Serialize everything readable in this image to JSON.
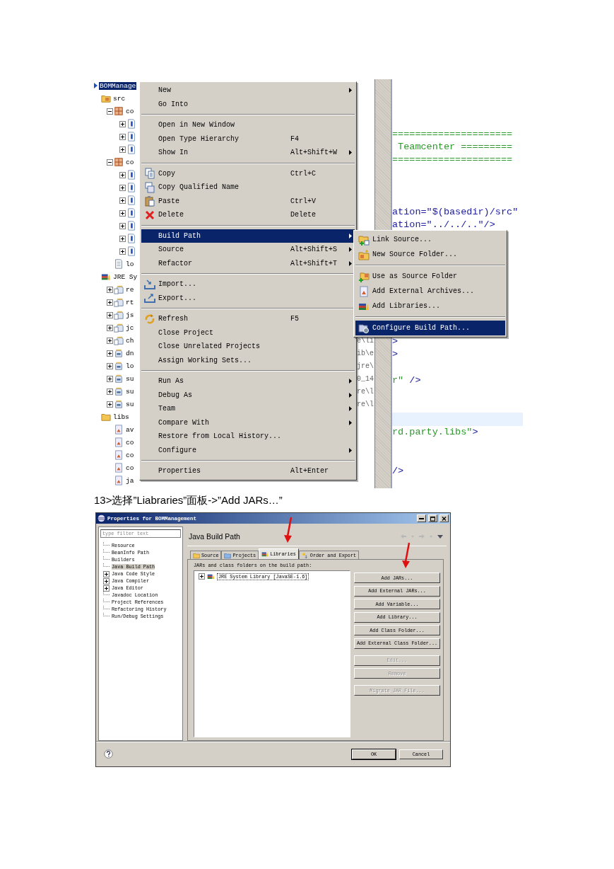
{
  "explorer": {
    "tree": [
      {
        "label": "BOMManage",
        "kind": "project",
        "selected": true,
        "children": [
          {
            "label": "src",
            "kind": "source-folder",
            "selected": false,
            "children": [
              {
                "label": "co",
                "kind": "package",
                "expanded": true,
                "selected": false,
                "children": [
                  {
                    "kind": "java",
                    "expanded": false,
                    "selected": false
                  },
                  {
                    "kind": "java",
                    "expanded": false,
                    "selected": false
                  },
                  {
                    "kind": "java",
                    "expanded": false,
                    "selected": false
                  }
                ]
              },
              {
                "label": "co",
                "kind": "package",
                "expanded": true,
                "selected": false,
                "children": [
                  {
                    "kind": "java",
                    "expanded": false,
                    "selected": false
                  },
                  {
                    "kind": "java",
                    "expanded": false,
                    "selected": false
                  },
                  {
                    "kind": "java",
                    "expanded": false,
                    "selected": false
                  },
                  {
                    "kind": "java",
                    "expanded": false,
                    "selected": false
                  },
                  {
                    "kind": "java",
                    "expanded": false,
                    "selected": false
                  },
                  {
                    "kind": "java",
                    "expanded": false,
                    "selected": false
                  },
                  {
                    "kind": "java",
                    "expanded": false,
                    "selected": false
                  }
                ]
              },
              {
                "label": "lo",
                "kind": "file",
                "selected": false
              }
            ]
          },
          {
            "label": "JRE Sy",
            "kind": "library",
            "selected": false,
            "children": [
              {
                "label": "re",
                "kind": "source-jar",
                "expanded": false,
                "selected": false
              },
              {
                "label": "rt",
                "kind": "source-jar",
                "expanded": false,
                "selected": false
              },
              {
                "label": "js",
                "kind": "source-jar",
                "expanded": false,
                "selected": false
              },
              {
                "label": "jc",
                "kind": "source-jar",
                "expanded": false,
                "selected": false
              },
              {
                "label": "ch",
                "kind": "source-jar",
                "expanded": false,
                "selected": false,
                "tail": "e\\li"
              },
              {
                "label": "dn",
                "kind": "jar",
                "expanded": false,
                "selected": false,
                "tail": "ib\\e"
              },
              {
                "label": "lo",
                "kind": "jar",
                "expanded": false,
                "selected": false,
                "tail": "jre\\"
              },
              {
                "label": "su",
                "kind": "jar",
                "expanded": false,
                "selected": false,
                "tail": "0_14"
              },
              {
                "label": "su",
                "kind": "jar",
                "expanded": false,
                "selected": false,
                "tail": "re\\l"
              },
              {
                "label": "su",
                "kind": "jar",
                "expanded": false,
                "selected": false,
                "tail": "re\\l"
              }
            ]
          },
          {
            "label": "libs",
            "kind": "folder",
            "selected": false,
            "children": [
              {
                "label": "av",
                "kind": "archive",
                "selected": false
              },
              {
                "label": "co",
                "kind": "archive",
                "selected": false
              },
              {
                "label": "co",
                "kind": "archive",
                "selected": false
              },
              {
                "label": "co",
                "kind": "archive",
                "selected": false
              },
              {
                "label": "ja",
                "kind": "archive",
                "selected": false
              }
            ]
          }
        ]
      }
    ]
  },
  "context_menu": {
    "items": [
      {
        "kind": "item",
        "label": "New",
        "has_submenu": true,
        "selected": false
      },
      {
        "kind": "item",
        "label": "Go Into",
        "has_submenu": false,
        "selected": false
      },
      {
        "kind": "separator"
      },
      {
        "kind": "item",
        "label": "Open in New Window",
        "has_submenu": false,
        "selected": false
      },
      {
        "kind": "item",
        "label": "Open Type Hierarchy",
        "shortcut": "F4",
        "has_submenu": false,
        "selected": false
      },
      {
        "kind": "item",
        "label": "Show In",
        "shortcut": "Alt+Shift+W",
        "has_submenu": true,
        "selected": false
      },
      {
        "kind": "separator"
      },
      {
        "kind": "copy",
        "label": "Copy",
        "shortcut": "Ctrl+C",
        "has_submenu": false,
        "selected": false
      },
      {
        "kind": "copyname",
        "label": "Copy Qualified Name",
        "has_submenu": false,
        "selected": false
      },
      {
        "kind": "paste",
        "label": "Paste",
        "shortcut": "Ctrl+V",
        "has_submenu": false,
        "selected": false
      },
      {
        "kind": "delete",
        "label": "Delete",
        "shortcut": "Delete",
        "has_submenu": false,
        "selected": false
      },
      {
        "kind": "separator"
      },
      {
        "kind": "item",
        "label": "Build Path",
        "has_submenu": true,
        "selected": true
      },
      {
        "kind": "item",
        "label": "Source",
        "shortcut": "Alt+Shift+S",
        "has_submenu": true,
        "selected": false
      },
      {
        "kind": "item",
        "label": "Refactor",
        "shortcut": "Alt+Shift+T",
        "has_submenu": true,
        "selected": false
      },
      {
        "kind": "separator"
      },
      {
        "kind": "import",
        "label": "Import...",
        "has_submenu": false,
        "selected": false
      },
      {
        "kind": "export",
        "label": "Export...",
        "has_submenu": false,
        "selected": false
      },
      {
        "kind": "separator"
      },
      {
        "kind": "refresh",
        "label": "Refresh",
        "shortcut": "F5",
        "has_submenu": false,
        "selected": false
      },
      {
        "kind": "item",
        "label": "Close Project",
        "has_submenu": false,
        "selected": false
      },
      {
        "kind": "item",
        "label": "Close Unrelated Projects",
        "has_submenu": false,
        "selected": false
      },
      {
        "kind": "item",
        "label": "Assign Working Sets...",
        "has_submenu": false,
        "selected": false
      },
      {
        "kind": "separator"
      },
      {
        "kind": "item",
        "label": "Run As",
        "has_submenu": true,
        "selected": false
      },
      {
        "kind": "item",
        "label": "Debug As",
        "has_submenu": true,
        "selected": false
      },
      {
        "kind": "item",
        "label": "Team",
        "has_submenu": true,
        "selected": false
      },
      {
        "kind": "item",
        "label": "Compare With",
        "has_submenu": true,
        "selected": false
      },
      {
        "kind": "item",
        "label": "Restore from Local History...",
        "has_submenu": false,
        "selected": false
      },
      {
        "kind": "item",
        "label": "Configure",
        "has_submenu": true,
        "selected": false
      },
      {
        "kind": "separator"
      },
      {
        "kind": "item",
        "label": "Properties",
        "shortcut": "Alt+Enter",
        "has_submenu": false,
        "selected": false
      }
    ]
  },
  "submenu": {
    "items": [
      {
        "kind": "link",
        "label": "Link Source...",
        "selected": false
      },
      {
        "kind": "newfolder",
        "label": "New Source Folder...",
        "selected": false
      },
      {
        "kind": "separator"
      },
      {
        "kind": "usesource",
        "label": "Use as Source Folder",
        "selected": false
      },
      {
        "kind": "archive",
        "label": "Add External Archives...",
        "selected": false
      },
      {
        "kind": "libraries",
        "label": "Add Libraries...",
        "selected": false
      },
      {
        "kind": "separator"
      },
      {
        "kind": "configure",
        "label": "Configure Build Path...",
        "selected": true
      }
    ]
  },
  "editor": {
    "lines": [
      {
        "kind": "blank"
      },
      {
        "kind": "blank"
      },
      {
        "kind": "blank"
      },
      {
        "kind": "code",
        "segments": [
          {
            "kind": "comment",
            "text": "====================="
          }
        ]
      },
      {
        "kind": "code",
        "segments": [
          {
            "kind": "comment",
            "text": " Teamcenter ========="
          }
        ]
      },
      {
        "kind": "code",
        "segments": [
          {
            "kind": "comment",
            "text": "====================="
          }
        ]
      },
      {
        "kind": "blank"
      },
      {
        "kind": "blank"
      },
      {
        "kind": "blank"
      },
      {
        "kind": "code",
        "segments": [
          {
            "kind": "markup",
            "text": "ation=\"$(basedir)/src\""
          }
        ]
      },
      {
        "kind": "code",
        "segments": [
          {
            "kind": "markup",
            "text": "ation=\"../../..\"/>"
          }
        ]
      },
      {
        "kind": "blank"
      },
      {
        "kind": "blank"
      },
      {
        "kind": "blank"
      },
      {
        "kind": "blank"
      },
      {
        "kind": "blank"
      },
      {
        "kind": "blank"
      },
      {
        "kind": "blank"
      },
      {
        "kind": "blank"
      },
      {
        "kind": "code",
        "segments": [
          {
            "kind": "markup",
            "text": ">"
          }
        ]
      },
      {
        "kind": "code",
        "segments": [
          {
            "kind": "markup",
            "text": ">"
          }
        ]
      },
      {
        "kind": "blank"
      },
      {
        "kind": "code",
        "segments": [
          {
            "kind": "comment",
            "text": "r\""
          },
          {
            "kind": "markup",
            "text": " />"
          }
        ]
      },
      {
        "kind": "blank"
      },
      {
        "kind": "blank"
      },
      {
        "kind": "current"
      },
      {
        "kind": "code",
        "segments": [
          {
            "kind": "comment",
            "text": "rd.party.libs\""
          },
          {
            "kind": "markup",
            "text": ">"
          }
        ]
      },
      {
        "kind": "blank"
      },
      {
        "kind": "blank"
      },
      {
        "kind": "code",
        "segments": [
          {
            "kind": "markup",
            "text": "/>"
          }
        ]
      }
    ]
  },
  "caption": "13>选择”Liabraries”面板->”Add JARs…”",
  "dialog": {
    "title": "Properties for BOMManagement",
    "filter": {
      "placeholder": "type filter text"
    },
    "nav": [
      {
        "label": "Resource",
        "selected": false
      },
      {
        "label": "BeanInfo Path",
        "selected": false
      },
      {
        "label": "Builders",
        "selected": false
      },
      {
        "label": "Java Build Path",
        "selected": true
      },
      {
        "label": "Java Code Style",
        "selected": false,
        "expanded": false
      },
      {
        "label": "Java Compiler",
        "selected": false,
        "expanded": false
      },
      {
        "label": "Java Editor",
        "selected": false,
        "expanded": false
      },
      {
        "label": "Javadoc Location",
        "selected": false
      },
      {
        "label": "Project References",
        "selected": false
      },
      {
        "label": "Refactoring History",
        "selected": false
      },
      {
        "label": "Run/Debug Settings",
        "selected": false
      }
    ],
    "page_title": "Java Build Path",
    "tabs": [
      {
        "kind": "source",
        "label": "Source",
        "selected": false
      },
      {
        "kind": "projects",
        "label": "Projects",
        "selected": false
      },
      {
        "kind": "libraries",
        "label": "Libraries",
        "selected": true
      },
      {
        "kind": "order",
        "label": "Order and Export",
        "selected": false
      }
    ],
    "list_label": "JARs and class folders on the build path:",
    "entries": [
      {
        "label": "JRE System Library [JavaSE-1.6]",
        "expanded": false
      }
    ],
    "button_groups": [
      [
        {
          "label": "Add JARs...",
          "disabled": false
        },
        {
          "label": "Add External JARs...",
          "disabled": false
        },
        {
          "label": "Add Variable...",
          "disabled": false
        },
        {
          "label": "Add Library...",
          "disabled": false
        },
        {
          "label": "Add Class Folder...",
          "disabled": false
        },
        {
          "label": "Add External Class Folder...",
          "disabled": false
        }
      ],
      [
        {
          "label": "Edit...",
          "disabled": true
        },
        {
          "label": "Remove",
          "disabled": true
        }
      ],
      [
        {
          "label": "Migrate JAR File...",
          "disabled": true
        }
      ]
    ],
    "footer_buttons": [
      "OK",
      "Cancel"
    ]
  }
}
